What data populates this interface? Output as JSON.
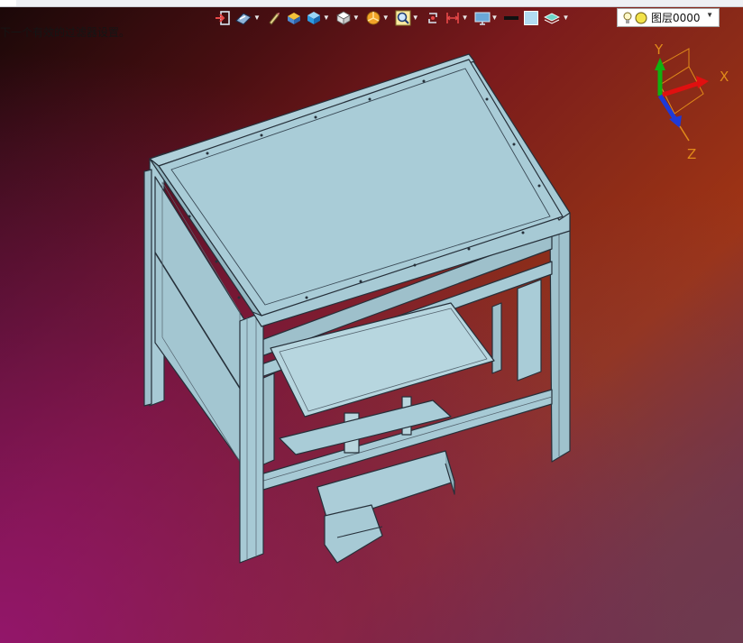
{
  "status": {
    "message": "下一个有效的过滤器设置。"
  },
  "toolbar": {
    "buttons": [
      {
        "id": "exit",
        "icon": "exit-icon",
        "has_menu": false
      },
      {
        "id": "view",
        "icon": "view-direction-icon",
        "has_menu": true
      },
      {
        "id": "pencil",
        "icon": "pencil-icon",
        "has_menu": false
      },
      {
        "id": "shade",
        "icon": "shading-icon",
        "has_menu": false
      },
      {
        "id": "display",
        "icon": "display-mode-icon",
        "has_menu": true
      },
      {
        "id": "cube",
        "icon": "cube-icon",
        "has_menu": true
      },
      {
        "id": "render",
        "icon": "render-icon",
        "has_menu": true
      },
      {
        "id": "zoom",
        "icon": "zoom-icon",
        "has_menu": true
      },
      {
        "id": "rotate",
        "icon": "rotate-icon",
        "has_menu": false
      },
      {
        "id": "measure",
        "icon": "measure-icon",
        "has_menu": true
      },
      {
        "id": "monitor",
        "icon": "monitor-icon",
        "has_menu": true
      },
      {
        "id": "linecolor",
        "icon": "line-color-icon",
        "has_menu": false
      },
      {
        "id": "fillcolor",
        "icon": "fill-color-icon",
        "has_menu": false
      },
      {
        "id": "layerview",
        "icon": "layer-view-icon",
        "has_menu": true
      }
    ]
  },
  "layer": {
    "selected": "图层0000",
    "bulb_icon": "bulb-icon",
    "dot_icon": "layer-dot-icon"
  },
  "triad": {
    "x_label": "X",
    "y_label": "Y",
    "z_label": "Z"
  },
  "colors": {
    "model_fill": "#a9ccd7",
    "model_edge": "#26303a",
    "x_axis": "#e01010",
    "y_axis": "#10b010",
    "z_axis": "#1e3ad8",
    "axis_label": "#e08a1a"
  }
}
